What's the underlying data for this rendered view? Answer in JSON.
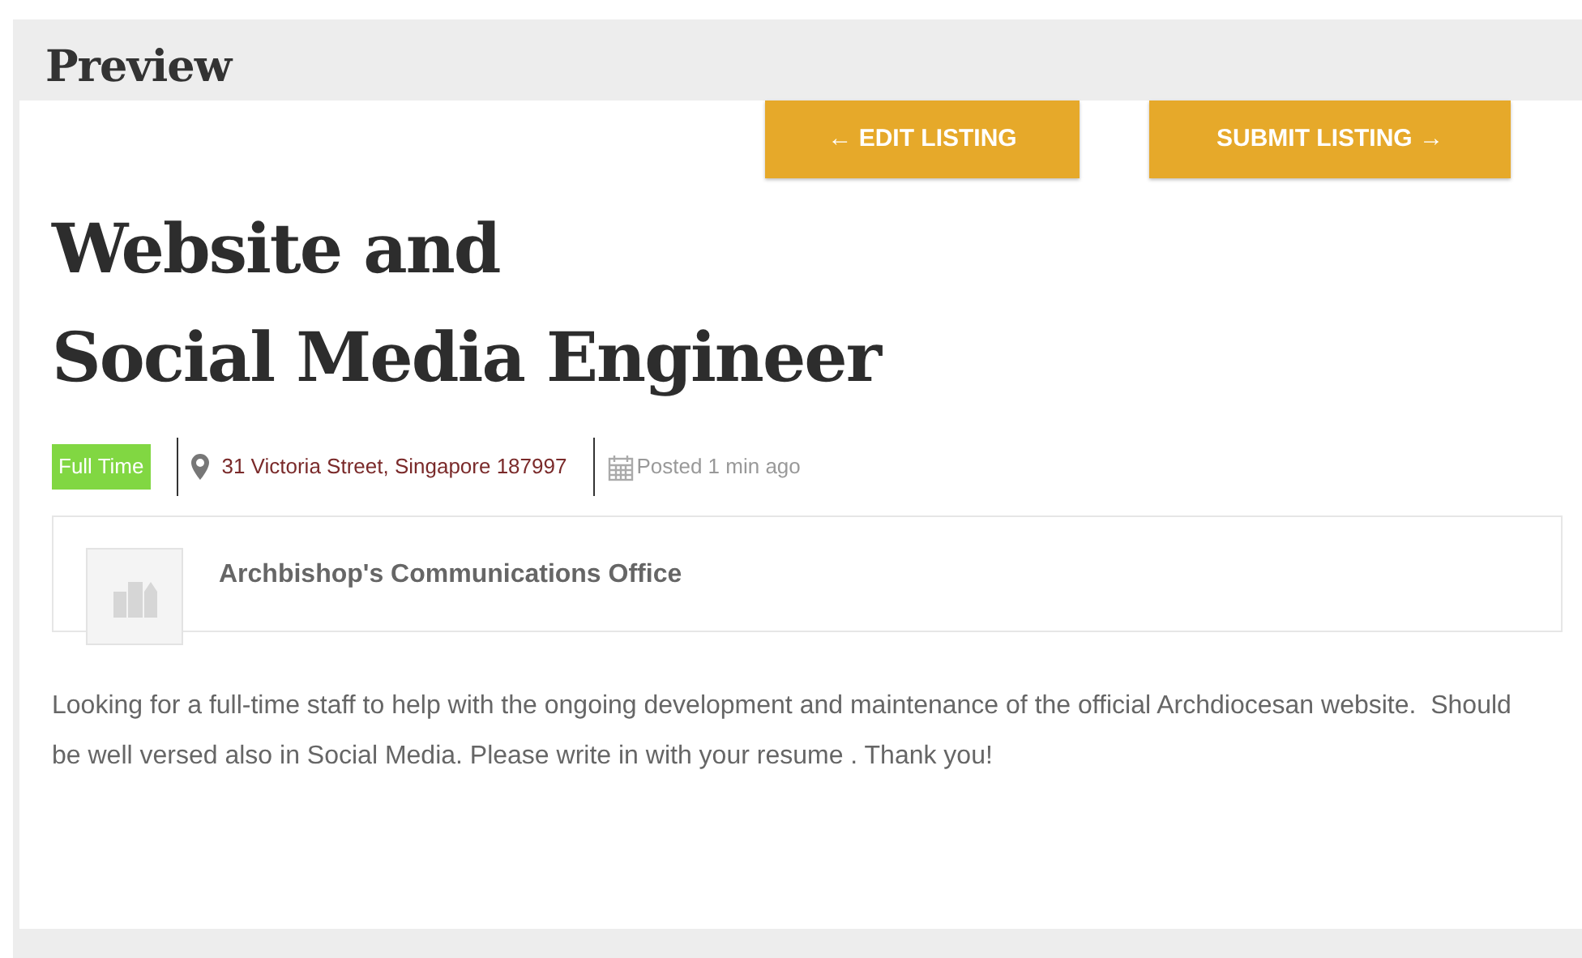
{
  "header": {
    "title": "Preview"
  },
  "buttons": [
    {
      "label": "← EDIT LISTING"
    },
    {
      "label": "SUBMIT LISTING →"
    }
  ],
  "job": {
    "title_lines": [
      "Website and",
      "Social Media Engineer"
    ],
    "type": {
      "label": "Full Time",
      "color": "#81d742"
    },
    "location": "31 Victoria Street, Singapore 187997",
    "posted": "Posted 1 min ago"
  },
  "company": {
    "name": "Archbishop's Communications Office"
  },
  "description": "Looking for a full-time staff to help with the ongoing development and maintenance of the official Archdiocesan website.  Should be well versed also in Social Media. Please write in with your resume . Thank you!"
}
